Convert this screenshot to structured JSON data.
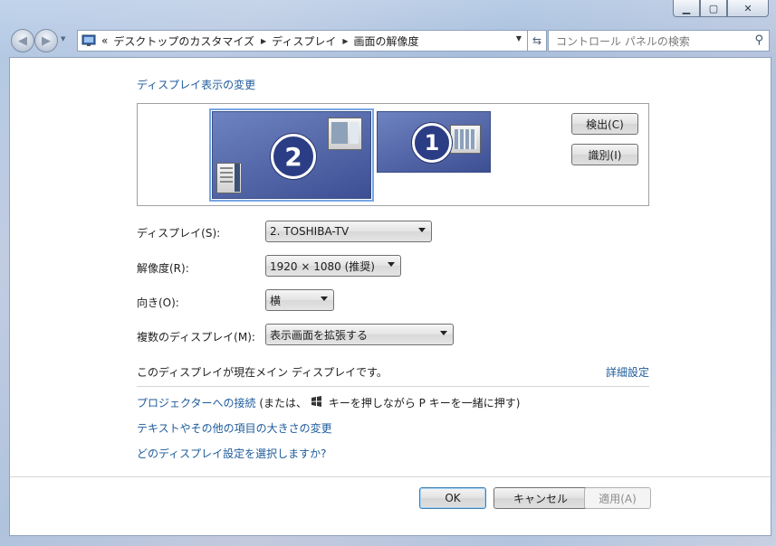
{
  "window": {
    "minimize_icon": "minimize-icon",
    "maximize_icon": "maximize-icon",
    "close_icon": "close-icon"
  },
  "navigation": {
    "breadcrumb": {
      "prefix": "«",
      "items": [
        "デスクトップのカスタマイズ",
        "ディスプレイ",
        "画面の解像度"
      ]
    },
    "search_placeholder": "コントロール パネルの検索"
  },
  "main": {
    "heading": "ディスプレイ表示の変更",
    "monitors": [
      {
        "number": "2",
        "selected": true
      },
      {
        "number": "1",
        "selected": false
      }
    ],
    "detect_button": "検出(C)",
    "identify_button": "識別(I)",
    "display_label": "ディスプレイ(S):",
    "display_value": "2. TOSHIBA-TV",
    "resolution_label": "解像度(R):",
    "resolution_value": "1920 × 1080 (推奨)",
    "orientation_label": "向き(O):",
    "orientation_value": "横",
    "multiple_label": "複数のディスプレイ(M):",
    "multiple_value": "表示画面を拡張する",
    "status_text": "このディスプレイが現在メイン ディスプレイです。",
    "advanced_link": "詳細設定",
    "projector_link": "プロジェクターへの接続",
    "projector_hint_before": " (または、",
    "projector_hint_after": " キーを押しながら P キーを一緒に押す)",
    "text_size_link": "テキストやその他の項目の大きさの変更",
    "which_settings_link": "どのディスプレイ設定を選択しますか?"
  },
  "footer": {
    "ok_button": "OK",
    "cancel_button": "キャンセル",
    "apply_button": "適用(A)"
  }
}
